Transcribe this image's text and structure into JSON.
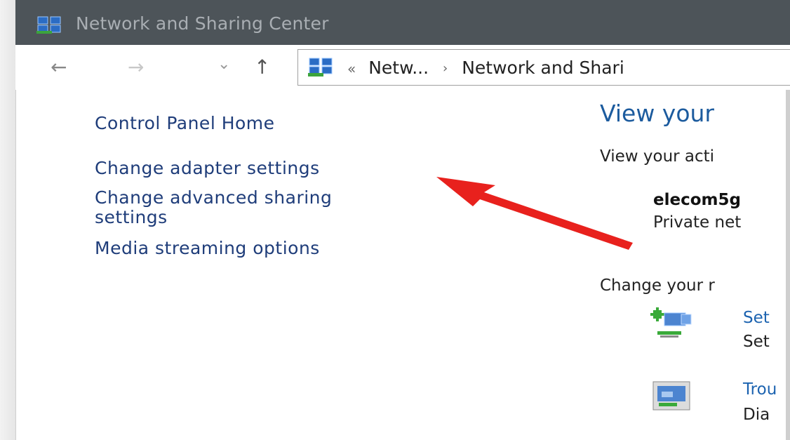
{
  "window": {
    "title": "Network and Sharing Center"
  },
  "nav": {
    "back": "←",
    "forward": "→",
    "recent": "⌄",
    "up": "↑",
    "breadcrumb": {
      "overflow": "«",
      "items": [
        "Netw...",
        "Network and Shari"
      ],
      "separator": "›"
    }
  },
  "sidebar": {
    "items": [
      {
        "label": "Control Panel Home"
      },
      {
        "label": "Change adapter settings"
      },
      {
        "label": "Change advanced sharing",
        "label2": "settings"
      },
      {
        "label": "Media streaming options"
      }
    ]
  },
  "main": {
    "heading": "View your",
    "subheading": "View your acti",
    "network_name": "elecom5g",
    "network_type": "Private net",
    "change_heading": "Change your r",
    "tasks": [
      {
        "link": "Set",
        "desc": "Set",
        "icon": "network-setup-icon"
      },
      {
        "link": "Trou",
        "desc": "Dia",
        "icon": "troubleshoot-icon"
      }
    ]
  },
  "annotation": {
    "icon": "red-arrow-icon",
    "color": "#e8211d"
  }
}
